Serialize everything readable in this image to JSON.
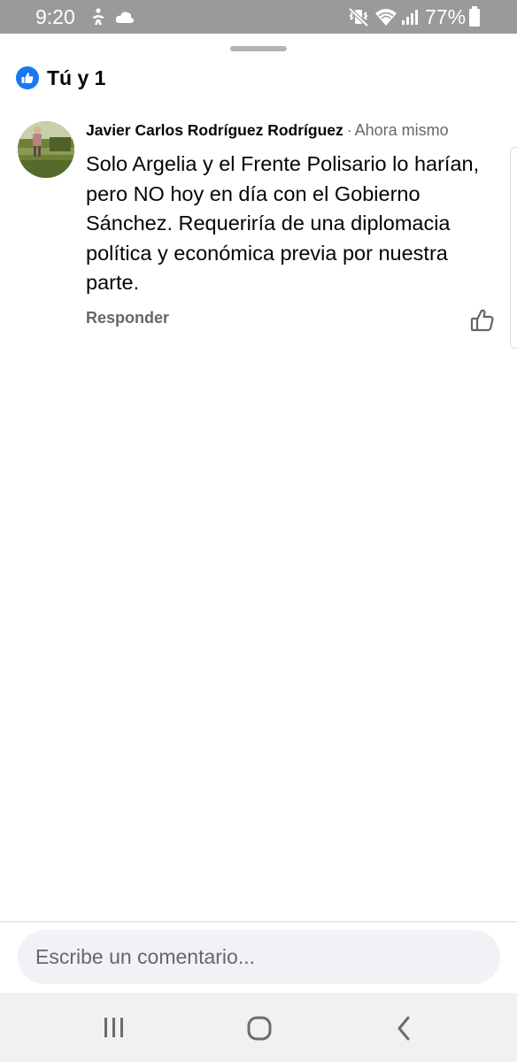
{
  "status_bar": {
    "time": "9:20",
    "battery": "77%",
    "icons": [
      "accessibility-icon",
      "cloud-icon",
      "mute-vibrate-icon",
      "wifi-icon",
      "signal-icon",
      "battery-icon"
    ]
  },
  "reactions": {
    "summary": "Tú y 1",
    "icon": "like-icon",
    "accent_color": "#1877f2"
  },
  "comment": {
    "author": "Javier Carlos Rodríguez Rodríguez",
    "separator": "·",
    "time": "Ahora mismo",
    "text": "Solo Argelia y el Frente Polisario lo harían, pero NO hoy en día con el Gobierno Sánchez. Requeriría de una diplomacia política y económica previa por nuestra parte.",
    "reply_label": "Responder",
    "like_icon": "thumbs-up-outline-icon"
  },
  "composer": {
    "placeholder": "Escribe un comentario..."
  },
  "nav_bar": {
    "buttons": [
      "recent-apps-icon",
      "home-icon",
      "back-icon"
    ]
  }
}
